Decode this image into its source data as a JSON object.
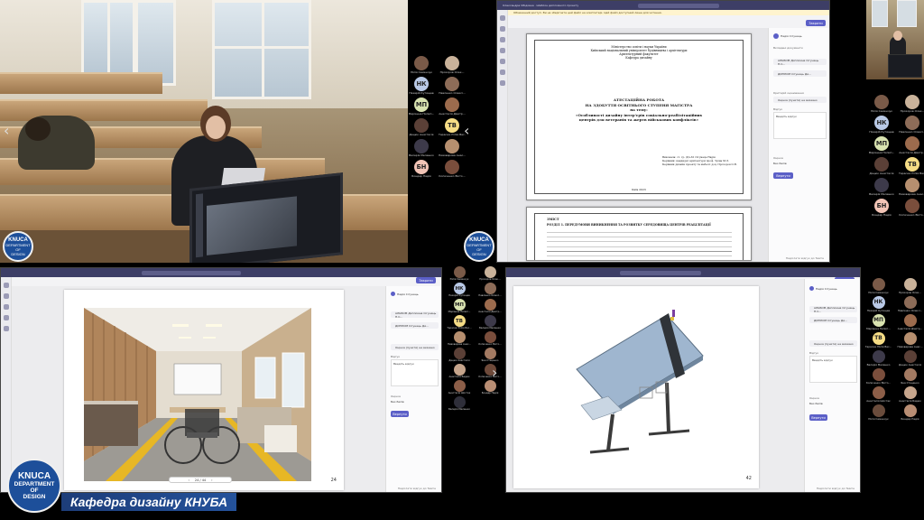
{
  "meeting": {
    "caption": "Кафедра дизайну КНУБА",
    "logo": {
      "line1": "KNUCA",
      "line2": "DEPARTMENT",
      "line3": "OF",
      "line4": "DESIGN"
    },
    "prev_icon": "chevron-left-icon",
    "next_icon": "chevron-right-icon"
  },
  "shared_top": {
    "title_bar": "Олександра Обідовна · Шаблон дипломного проекту",
    "notification": "Обмежений доступ. Ви не зберігаєте цей файл на комп'ютері. Цей файл доступний лише для читання.",
    "present_button": "Закрити",
    "doc_header": [
      "Міністерство освіти і науки України",
      "Київський національний університет будівництва і архітектури",
      "Архітектурний факультет",
      "Кафедра дизайну"
    ],
    "doc_title": [
      "АТЕСТАЦІЙНА РОБОТА",
      "НА ЗДОБУТТЯ ОСВІТНЬОГО СТУПЕНЯ МАГІСТРА",
      "на тему:",
      "«Особливості дизайну інтер'єрів соціально-реабілітаційних",
      "центрів для ветеранів та жертв військових конфліктів»"
    ],
    "doc_authors": [
      "Виконала: ст. гр. ДІз-61 Сігунець Надія",
      "Керівник: кандидат архітектури проф. Зуєва М.Л.",
      "Керівник дизайн проекту та мебелі: доц. Прохоров О.В."
    ],
    "doc_city": "Київ 2023",
    "toc_header": "ЗМІСТ",
    "toc_section": "РОЗДІЛ 1. ПЕРЕДУМОВИ ВИНИКНЕННЯ ТА РОЗВИТКУ СЕРЕДОВИЩА ЦЕНТРІВ РЕАБІЛІТАЦІЇ",
    "sidepane": {
      "user": "Надія Сігунець",
      "label_files": "Вкладені документи",
      "file1": "АЛЬБОМ Дипломна Сігунець Н.С...",
      "file2": "ДИПЛОМ Сігунець Ди...",
      "label_type": "Критерій оцінювання",
      "select": "Оцінка (пункти) не вказано",
      "label_feedback": "Відгук",
      "feedback": "Введіть відгук",
      "label_grade": "Оцінка",
      "grade": "Без балів",
      "return_button": "Вернути",
      "footer": "Надіслати відгук до Teams"
    }
  },
  "shared_bl": {
    "page_number": "24",
    "zoom_text": "24 / 44",
    "present_button": "Закрити"
  },
  "shared_br": {
    "page_number": "42",
    "present_button": "Закрити"
  },
  "participants_mid": [
    {
      "initials": "",
      "name": "Юлія Семенчук",
      "color": "#7a5a48"
    },
    {
      "initials": "",
      "name": "Прохоров Олек...",
      "color": "#c9b29a"
    },
    {
      "initials": "НК",
      "name": "Назарій Кутищев",
      "color": "#b9c9e6"
    },
    {
      "initials": "",
      "name": "Павленко Олексі...",
      "color": "#8d6c58"
    },
    {
      "initials": "МП",
      "name": "Маріанна Пилип...",
      "color": "#d9e3b0"
    },
    {
      "initials": "",
      "name": "Анастасія Дмитр...",
      "color": "#9c6b4d"
    },
    {
      "initials": "",
      "name": "Дацюк Анастасія",
      "color": "#5b4037"
    },
    {
      "initials": "ТВ",
      "name": "Тарасюк Юлія Вас...",
      "color": "#f5dc85"
    },
    {
      "initials": "",
      "name": "Валерія Мелешко",
      "color": "#3d3a4a"
    },
    {
      "initials": "",
      "name": "Пивоварова Анас...",
      "color": "#b68f6f"
    },
    {
      "initials": "БН",
      "name": "Бондар Надія",
      "color": "#f2c4b6"
    },
    {
      "initials": "",
      "name": "Копиченко Вікто...",
      "color": "#7a4e3c"
    }
  ],
  "participants_right": [
    {
      "initials": "",
      "name": "Юлія Семенчук",
      "color": "#7a5a48"
    },
    {
      "initials": "",
      "name": "Прохоров Олек...",
      "color": "#c9b29a"
    },
    {
      "initials": "НК",
      "name": "Назарій Кутищев",
      "color": "#b9c9e6"
    },
    {
      "initials": "",
      "name": "Павленко Олексі...",
      "color": "#8d6c58"
    },
    {
      "initials": "МП",
      "name": "Маріанна Пилип...",
      "color": "#d9e3b0"
    },
    {
      "initials": "",
      "name": "Анастасія Дмитр...",
      "color": "#9c6b4d"
    },
    {
      "initials": "",
      "name": "Дацюк Анастасія",
      "color": "#5b4037"
    },
    {
      "initials": "ТВ",
      "name": "Тарасюк Юлія Вас...",
      "color": "#f5dc85"
    },
    {
      "initials": "",
      "name": "Валерія Мелешко",
      "color": "#3d3a4a"
    },
    {
      "initials": "",
      "name": "Пивоварова Анас...",
      "color": "#b68f6f"
    },
    {
      "initials": "БН",
      "name": "Бондар Надія",
      "color": "#f2c4b6"
    },
    {
      "initials": "",
      "name": "Копиченко Вікто...",
      "color": "#7a4e3c"
    }
  ],
  "participants_mid2": [
    {
      "initials": "",
      "name": "Юлія Семенчук",
      "color": "#7a5a48"
    },
    {
      "initials": "",
      "name": "Прохоров Олек...",
      "color": "#c9b29a"
    },
    {
      "initials": "НК",
      "name": "Назарій Кутищев",
      "color": "#b9c9e6"
    },
    {
      "initials": "",
      "name": "Павленко Олексі...",
      "color": "#8d6c58"
    },
    {
      "initials": "МП",
      "name": "Маріанна Пилип...",
      "color": "#d9e3b0"
    },
    {
      "initials": "",
      "name": "Анастасія Дмитр...",
      "color": "#9c6b4d"
    },
    {
      "initials": "ТВ",
      "name": "Тарасюк Юлія Вас...",
      "color": "#f5dc85"
    },
    {
      "initials": "",
      "name": "Валерія Мелешко",
      "color": "#3d3a4a"
    },
    {
      "initials": "",
      "name": "Пивоварова Анас...",
      "color": "#b68f6f"
    },
    {
      "initials": "",
      "name": "Копиченко Вікто...",
      "color": "#7a4e3c"
    },
    {
      "initials": "",
      "name": "Дацюк Анастасія",
      "color": "#5b4037"
    },
    {
      "initials": "",
      "name": "Яна Стеценко",
      "color": "#a37a62"
    },
    {
      "initials": "",
      "name": "Анастасія Бадюк",
      "color": "#c6a58c"
    },
    {
      "initials": "",
      "name": "Копиченко Вікто...",
      "color": "#6e4a3a"
    },
    {
      "initials": "",
      "name": "Анастасія Шостак",
      "color": "#8c5e48"
    },
    {
      "initials": "",
      "name": "Бондар Надія",
      "color": "#b98e74"
    },
    {
      "initials": "",
      "name": "Валерія Мелешко",
      "color": "#2f2f3a"
    }
  ],
  "participants_right2": [
    {
      "initials": "",
      "name": "Юлія Семенчук",
      "color": "#7a5a48"
    },
    {
      "initials": "",
      "name": "Прохоров Олек...",
      "color": "#c9b29a"
    },
    {
      "initials": "НК",
      "name": "Назарій Кутищев",
      "color": "#b9c9e6"
    },
    {
      "initials": "",
      "name": "Павленко Олексі...",
      "color": "#8d6c58"
    },
    {
      "initials": "МП",
      "name": "Маріанна Пилип...",
      "color": "#d9e3b0"
    },
    {
      "initials": "",
      "name": "Анастасія Дмитр...",
      "color": "#9c6b4d"
    },
    {
      "initials": "ТВ",
      "name": "Тарасюк Юлія Вас...",
      "color": "#f5dc85"
    },
    {
      "initials": "",
      "name": "Пивоварова Анас...",
      "color": "#b68f6f"
    },
    {
      "initials": "",
      "name": "Валерія Мелешко",
      "color": "#3d3a4a"
    },
    {
      "initials": "",
      "name": "Дацюк Анастасія",
      "color": "#5b4037"
    },
    {
      "initials": "",
      "name": "Копиченко Вікто...",
      "color": "#7a4e3c"
    },
    {
      "initials": "",
      "name": "Яна Стеценко",
      "color": "#a37a62"
    },
    {
      "initials": "",
      "name": "Анастасія Шостак",
      "color": "#8c5e48"
    },
    {
      "initials": "",
      "name": "Анастасія Бадюк",
      "color": "#c6a58c"
    },
    {
      "initials": "",
      "name": "Юлія Семенчук",
      "color": "#6a4c3c"
    },
    {
      "initials": "",
      "name": "Бондар Надія",
      "color": "#b98e74"
    }
  ]
}
